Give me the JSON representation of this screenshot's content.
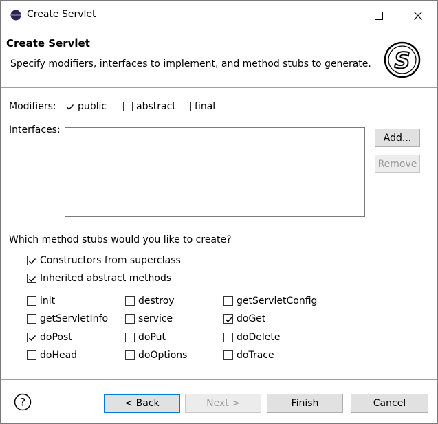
{
  "window": {
    "title": "Create Servlet",
    "minimize_glyph": "—",
    "maximize_glyph": "☐",
    "close_glyph": "✕"
  },
  "banner": {
    "title": "Create Servlet",
    "description": "Specify modifiers, interfaces to implement, and method stubs to generate.",
    "logo_letter": "S"
  },
  "modifiers": {
    "label": "Modifiers:",
    "options": [
      {
        "label": "public",
        "checked": true
      },
      {
        "label": "abstract",
        "checked": false
      },
      {
        "label": "final",
        "checked": false
      }
    ]
  },
  "interfaces": {
    "label": "Interfaces:",
    "add_label": "Add...",
    "remove_label": "Remove"
  },
  "stubs": {
    "question": "Which method stubs would you like to create?",
    "general": [
      {
        "label": "Constructors from superclass",
        "checked": true
      },
      {
        "label": "Inherited abstract methods",
        "checked": true
      }
    ],
    "methods": [
      {
        "label": "init",
        "checked": false
      },
      {
        "label": "destroy",
        "checked": false
      },
      {
        "label": "getServletConfig",
        "checked": false
      },
      {
        "label": "getServletInfo",
        "checked": false
      },
      {
        "label": "service",
        "checked": false
      },
      {
        "label": "doGet",
        "checked": true
      },
      {
        "label": "doPost",
        "checked": true
      },
      {
        "label": "doPut",
        "checked": false
      },
      {
        "label": "doDelete",
        "checked": false
      },
      {
        "label": "doHead",
        "checked": false
      },
      {
        "label": "doOptions",
        "checked": false
      },
      {
        "label": "doTrace",
        "checked": false
      }
    ]
  },
  "footer": {
    "help_glyph": "?",
    "back_label": "< Back",
    "next_label": "Next >",
    "finish_label": "Finish",
    "cancel_label": "Cancel"
  }
}
